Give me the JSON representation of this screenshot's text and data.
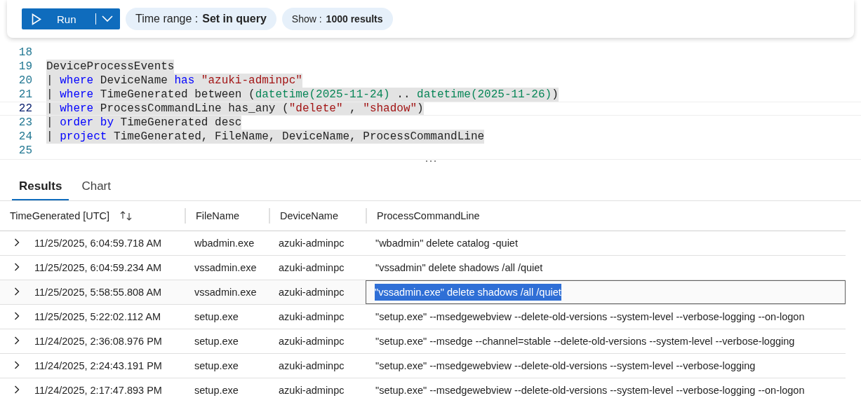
{
  "toolbar": {
    "run_button": {
      "label": "Run"
    },
    "time_range": {
      "label": "Time range :",
      "value": "Set in query"
    },
    "show": {
      "label": "Show :",
      "value": "1000 results"
    }
  },
  "editor": {
    "lines": [
      {
        "number": "18",
        "current": false
      },
      {
        "number": "19",
        "highlighted": true,
        "current": false,
        "tokens": [
          {
            "kind": "plain",
            "text": "DeviceProcessEvents"
          }
        ]
      },
      {
        "number": "20",
        "highlighted": true,
        "current": false,
        "tokens": [
          {
            "kind": "plain",
            "text": "| "
          },
          {
            "kind": "keyword",
            "text": "where"
          },
          {
            "kind": "plain",
            "text": " DeviceName "
          },
          {
            "kind": "keyword",
            "text": "has "
          },
          {
            "kind": "string",
            "text": "\"azuki-adminpc\""
          }
        ]
      },
      {
        "number": "21",
        "highlighted": true,
        "current": false,
        "tokens": [
          {
            "kind": "plain",
            "text": "| "
          },
          {
            "kind": "keyword",
            "text": "where"
          },
          {
            "kind": "plain",
            "text": " TimeGenerated between ("
          },
          {
            "kind": "function",
            "text": "datetime(2025-11-24)"
          },
          {
            "kind": "plain",
            "text": " .. "
          },
          {
            "kind": "function",
            "text": "datetime(2025-11-26)"
          },
          {
            "kind": "plain",
            "text": ")"
          }
        ]
      },
      {
        "number": "22",
        "highlighted": true,
        "current": true,
        "tokens": [
          {
            "kind": "plain",
            "text": "| "
          },
          {
            "kind": "keyword",
            "text": "where"
          },
          {
            "kind": "plain",
            "text": " ProcessCommandLine has_any ("
          },
          {
            "kind": "string",
            "text": "\"delete\""
          },
          {
            "kind": "plain",
            "text": " , "
          },
          {
            "kind": "string",
            "text": "\"shadow\""
          },
          {
            "kind": "plain",
            "text": ")"
          }
        ]
      },
      {
        "number": "23",
        "highlighted": true,
        "current": false,
        "tokens": [
          {
            "kind": "plain",
            "text": "| "
          },
          {
            "kind": "keyword",
            "text": "order by"
          },
          {
            "kind": "plain",
            "text": " TimeGenerated desc"
          }
        ]
      },
      {
        "number": "24",
        "highlighted": true,
        "current": false,
        "tokens": [
          {
            "kind": "plain",
            "text": "| "
          },
          {
            "kind": "keyword",
            "text": "project"
          },
          {
            "kind": "plain",
            "text": " TimeGenerated, FileName, DeviceName, ProcessCommandLine"
          }
        ]
      },
      {
        "number": "25",
        "current": false
      }
    ]
  },
  "tabs": [
    {
      "label": "Results",
      "selected": true
    },
    {
      "label": "Chart",
      "selected": false
    }
  ],
  "table": {
    "columns": [
      {
        "label": "TimeGenerated [UTC]",
        "sortable": true
      },
      {
        "label": "FileName",
        "sortable": false
      },
      {
        "label": "DeviceName",
        "sortable": false
      },
      {
        "label": "ProcessCommandLine",
        "sortable": false
      }
    ],
    "rows": [
      {
        "selected": false,
        "cells": [
          "11/25/2025, 6:04:59.718 AM",
          "wbadmin.exe",
          "azuki-adminpc",
          "\"wbadmin\" delete catalog -quiet"
        ]
      },
      {
        "selected": false,
        "cells": [
          "11/25/2025, 6:04:59.234 AM",
          "vssadmin.exe",
          "azuki-adminpc",
          "\"vssadmin\" delete shadows /all /quiet"
        ]
      },
      {
        "selected": true,
        "cells": [
          "11/25/2025, 5:58:55.808 AM",
          "vssadmin.exe",
          "azuki-adminpc",
          "\"vssadmin.exe\" delete shadows /all /quiet"
        ]
      },
      {
        "selected": false,
        "cells": [
          "11/25/2025, 5:22:02.112 AM",
          "setup.exe",
          "azuki-adminpc",
          "\"setup.exe\" --msedgewebview --delete-old-versions --system-level --verbose-logging --on-logon"
        ]
      },
      {
        "selected": false,
        "cells": [
          "11/24/2025, 2:36:08.976 PM",
          "setup.exe",
          "azuki-adminpc",
          "\"setup.exe\" --msedge --channel=stable --delete-old-versions --system-level --verbose-logging"
        ]
      },
      {
        "selected": false,
        "cells": [
          "11/24/2025, 2:24:43.191 PM",
          "setup.exe",
          "azuki-adminpc",
          "\"setup.exe\" --msedgewebview --delete-old-versions --system-level --verbose-logging"
        ]
      },
      {
        "selected": false,
        "cells": [
          "11/24/2025, 2:17:47.893 PM",
          "setup.exe",
          "azuki-adminpc",
          "\"setup.exe\" --msedgewebview --delete-old-versions --system-level --verbose-logging --on-logon"
        ]
      }
    ]
  }
}
